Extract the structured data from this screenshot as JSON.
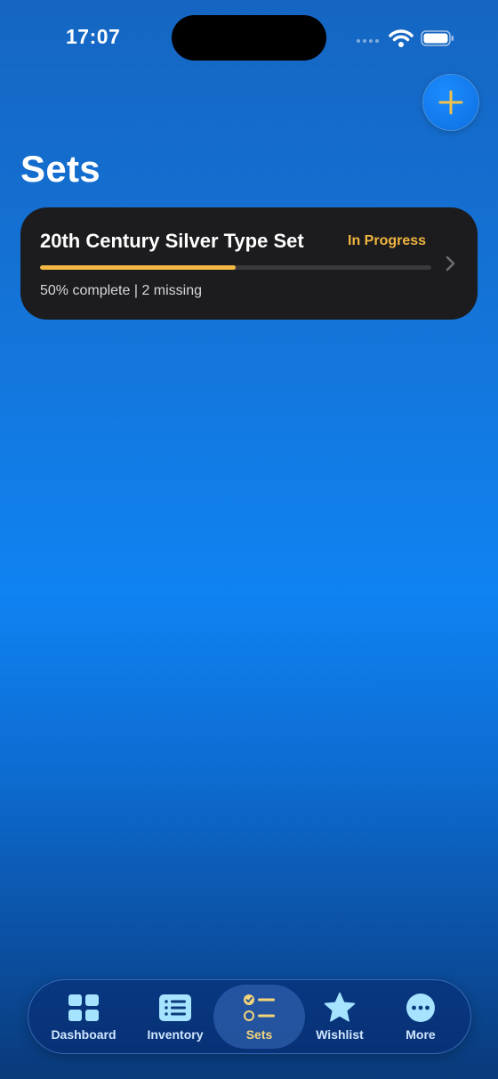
{
  "status_bar": {
    "time": "17:07"
  },
  "header": {
    "title": "Sets"
  },
  "sets": [
    {
      "name": "20th Century Silver Type Set",
      "status": "In Progress",
      "progress": 0.5,
      "meta": "50% complete | 2 missing"
    }
  ],
  "tab_bar": {
    "active": "Sets",
    "items": [
      {
        "label": "Dashboard",
        "icon": "grid-icon"
      },
      {
        "label": "Inventory",
        "icon": "list-icon"
      },
      {
        "label": "Sets",
        "icon": "checklist-icon"
      },
      {
        "label": "Wishlist",
        "icon": "star-icon"
      },
      {
        "label": "More",
        "icon": "ellipsis-icon"
      }
    ]
  },
  "colors": {
    "accent": "#f2b843",
    "card": "#1c1c1e",
    "tab_icon": "#a5e3ff"
  }
}
